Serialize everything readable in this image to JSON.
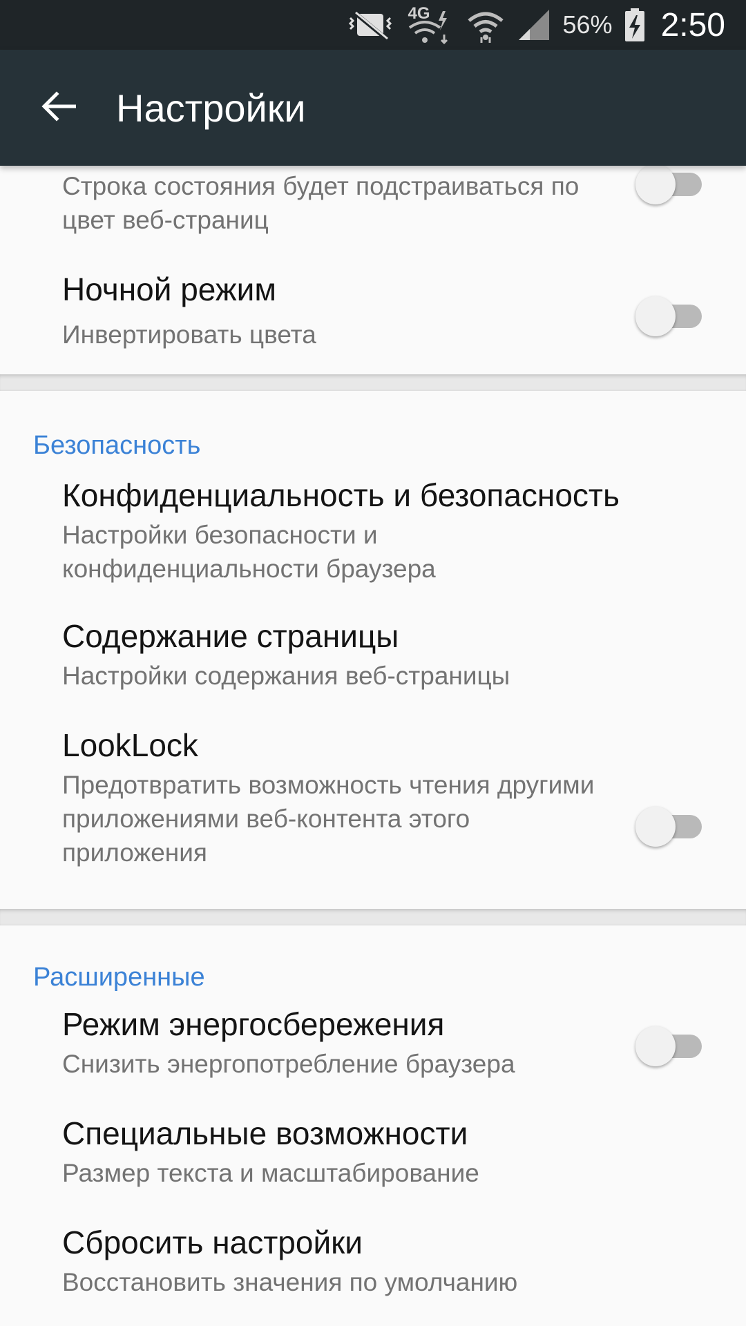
{
  "status_bar": {
    "battery_percent": "56%",
    "time": "2:50",
    "network_label": "4G",
    "icons": [
      "vibrate-mute-icon",
      "mobile-data-icon",
      "wifi-icon",
      "signal-icon",
      "battery-charging-icon"
    ]
  },
  "app_bar": {
    "title": "Настройки",
    "back_icon": "arrow-back-icon"
  },
  "sections": {
    "top": {
      "items": [
        {
          "summary": "Строка состояния будет подстраиваться по цвет веб-страниц",
          "switch_on": false
        },
        {
          "title": "Ночной режим",
          "summary": "Инвертировать цвета",
          "switch_on": false
        }
      ]
    },
    "security": {
      "header": "Безопасность",
      "items": [
        {
          "title": "Конфиденциальность и безопасность",
          "summary": "Настройки безопасности и конфиденциальности браузера"
        },
        {
          "title": "Содержание страницы",
          "summary": "Настройки содержания веб-страницы"
        },
        {
          "title": "LookLock",
          "summary": "Предотвратить возможность чтения другими приложениями веб-контента этого приложения",
          "switch_on": false
        }
      ]
    },
    "advanced": {
      "header": "Расширенные",
      "items": [
        {
          "title": "Режим энергосбережения",
          "summary": "Снизить энергопотребление браузера",
          "switch_on": false
        },
        {
          "title": "Специальные возможности",
          "summary": "Размер текста и масштабирование"
        },
        {
          "title": "Сбросить настройки",
          "summary": "Восстановить значения по умолчанию"
        }
      ]
    }
  },
  "colors": {
    "status_bar_bg": "#1f2528",
    "app_bar_bg": "#263238",
    "section_header": "#3b82d6",
    "background": "#fafafa"
  }
}
